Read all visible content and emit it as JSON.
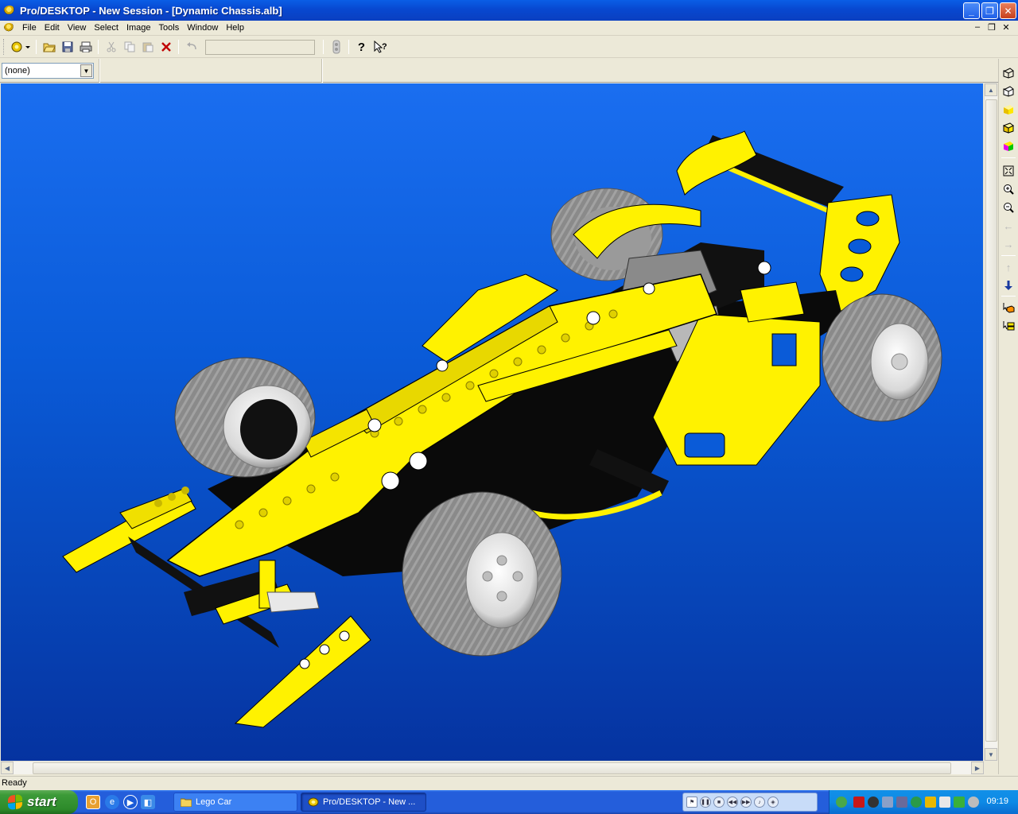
{
  "window": {
    "title": "Pro/DESKTOP - New Session - [Dynamic Chassis.alb]",
    "minimize": "_",
    "maximize": "❐",
    "close": "✕"
  },
  "menu": {
    "items": [
      "File",
      "Edit",
      "View",
      "Select",
      "Image",
      "Tools",
      "Window",
      "Help"
    ],
    "mdi_minimize": "–",
    "mdi_restore": "❐",
    "mdi_close": "✕"
  },
  "toolbar2": {
    "combo_value": "(none)"
  },
  "statusbar": {
    "text": "Ready"
  },
  "taskbar": {
    "start_label": "start",
    "tasks": [
      "Lego Car",
      "Pro/DESKTOP - New ..."
    ],
    "clock": "09:19"
  },
  "colors": {
    "viewport_top": "#1a6ef0",
    "viewport_bottom": "#0533a0",
    "part_yellow": "#fff200",
    "part_black": "#000000",
    "tire_gray": "#8c8c8c"
  }
}
